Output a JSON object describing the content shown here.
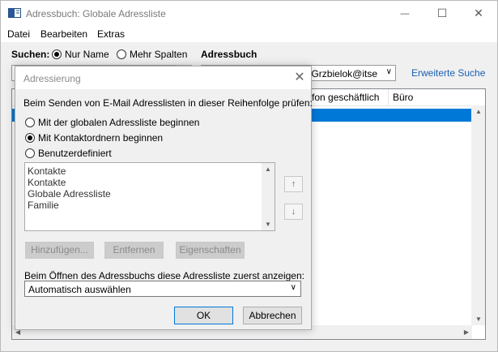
{
  "window": {
    "title": "Adressbuch: Globale Adressliste",
    "minimize_glyph": "—",
    "maximize_glyph": "☐",
    "close_glyph": "✕"
  },
  "menu": [
    "Datei",
    "Bearbeiten",
    "Extras"
  ],
  "search": {
    "label": "Suchen:",
    "option_name": "Nur Name",
    "option_columns": "Mehr Spalten",
    "selected": "Nur Name"
  },
  "addressbook": {
    "label": "Adressbuch",
    "value": "k.Grzbielok@itse",
    "advanced_search": "Erweiterte Suche"
  },
  "columns": [
    "fon geschäftlich",
    "Büro"
  ],
  "dialog": {
    "title": "Adressierung",
    "intro": "Beim Senden von E-Mail Adresslisten in dieser Reihenfolge prüfen:",
    "options": [
      "Mit der globalen Adressliste beginnen",
      "Mit Kontaktordnern beginnen",
      "Benutzerdefiniert"
    ],
    "selected_option": "Mit Kontaktordnern beginnen",
    "list_items": [
      "Kontakte",
      "Kontakte",
      "Globale Adressliste",
      "Familie"
    ],
    "buttons": {
      "add": "Hinzufügen...",
      "remove": "Entfernen",
      "properties": "Eigenschaften",
      "ok": "OK",
      "cancel": "Abbrechen"
    },
    "open_label": "Beim Öffnen des Adressbuchs diese Adressliste zuerst anzeigen:",
    "open_value": "Automatisch auswählen"
  },
  "colors": {
    "selection": "#0078d7",
    "link": "#1a5fb4"
  }
}
